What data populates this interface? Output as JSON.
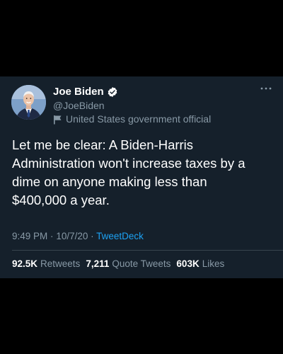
{
  "author": {
    "display_name": "Joe Biden",
    "handle": "@JoeBiden",
    "label": "United States government official",
    "verified": true
  },
  "tweet": {
    "text": "Let me be clear: A Biden-Harris\nAdministration won't increase taxes by a\ndime on anyone making less than\n$400,000 a year.",
    "time": "9:49 PM",
    "separator": "·",
    "date": "10/7/20",
    "source": "TweetDeck"
  },
  "stats": {
    "retweets_count": "92.5K",
    "retweets_label": "Retweets",
    "quote_count": "7,211",
    "quote_label": "Quote Tweets",
    "likes_count": "603K",
    "likes_label": "Likes"
  },
  "colors": {
    "page_bg": "#000000",
    "card_bg": "#15202b",
    "muted_text": "#8899a6",
    "accent": "#1da1f2",
    "divider": "#38444d"
  },
  "icons": {
    "verified": "verified-badge-icon",
    "flag": "flag-icon",
    "more": "more-horizontal-icon"
  }
}
